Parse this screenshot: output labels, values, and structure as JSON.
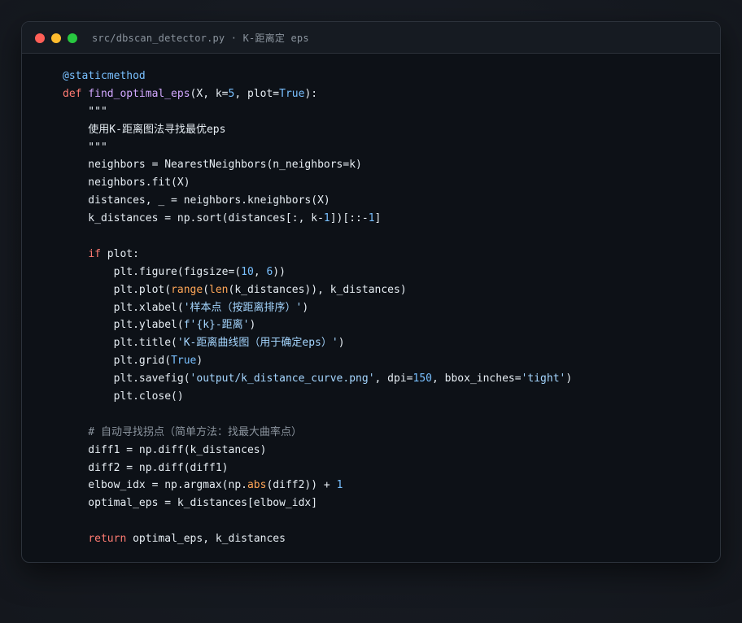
{
  "window": {
    "title": "src/dbscan_detector.py · K-距离定 eps",
    "controls": [
      "close",
      "minimize",
      "maximize"
    ]
  },
  "code": [
    [
      [
        "@staticmethod",
        "dec"
      ]
    ],
    [
      [
        "def ",
        "kw"
      ],
      [
        "find_optimal_eps",
        "fn"
      ],
      [
        "(X, k=",
        "plain"
      ],
      [
        "5",
        "num"
      ],
      [
        ", plot=",
        "plain"
      ],
      [
        "True",
        "const"
      ],
      [
        "):",
        "plain"
      ]
    ],
    [
      [
        "    \"\"\"",
        "doc"
      ]
    ],
    [
      [
        "    使用K-距离图法寻找最优eps",
        "doc"
      ]
    ],
    [
      [
        "    \"\"\"",
        "doc"
      ]
    ],
    [
      [
        "    neighbors = NearestNeighbors(n_neighbors=k)",
        "plain"
      ]
    ],
    [
      [
        "    neighbors.fit(X)",
        "plain"
      ]
    ],
    [
      [
        "    distances, _ = neighbors.kneighbors(X)",
        "plain"
      ]
    ],
    [
      [
        "    k_distances = np.sort(distances[:, k-",
        "plain"
      ],
      [
        "1",
        "num"
      ],
      [
        "])[::-",
        "plain"
      ],
      [
        "1",
        "num"
      ],
      [
        "]",
        "plain"
      ]
    ],
    [],
    [
      [
        "    ",
        "plain"
      ],
      [
        "if",
        "kw"
      ],
      [
        " plot:",
        "plain"
      ]
    ],
    [
      [
        "        plt.figure(figsize=(",
        "plain"
      ],
      [
        "10",
        "num"
      ],
      [
        ", ",
        "plain"
      ],
      [
        "6",
        "num"
      ],
      [
        "))",
        "plain"
      ]
    ],
    [
      [
        "        plt.plot(",
        "plain"
      ],
      [
        "range",
        "bi"
      ],
      [
        "(",
        "plain"
      ],
      [
        "len",
        "bi"
      ],
      [
        "(k_distances)), k_distances)",
        "plain"
      ]
    ],
    [
      [
        "        plt.xlabel(",
        "plain"
      ],
      [
        "'样本点（按距离排序）'",
        "str"
      ],
      [
        ")",
        "plain"
      ]
    ],
    [
      [
        "        plt.ylabel(",
        "plain"
      ],
      [
        "f'{k}-距离'",
        "str"
      ],
      [
        ")",
        "plain"
      ]
    ],
    [
      [
        "        plt.title(",
        "plain"
      ],
      [
        "'K-距离曲线图（用于确定eps）'",
        "str"
      ],
      [
        ")",
        "plain"
      ]
    ],
    [
      [
        "        plt.grid(",
        "plain"
      ],
      [
        "True",
        "const"
      ],
      [
        ")",
        "plain"
      ]
    ],
    [
      [
        "        plt.savefig(",
        "plain"
      ],
      [
        "'output/k_distance_curve.png'",
        "str"
      ],
      [
        ", dpi=",
        "plain"
      ],
      [
        "150",
        "num"
      ],
      [
        ", bbox_inches=",
        "plain"
      ],
      [
        "'tight'",
        "str"
      ],
      [
        ")",
        "plain"
      ]
    ],
    [
      [
        "        plt.close()",
        "plain"
      ]
    ],
    [],
    [
      [
        "    # 自动寻找拐点（简单方法：找最大曲率点）",
        "cmt"
      ]
    ],
    [
      [
        "    diff1 = np.diff(k_distances)",
        "plain"
      ]
    ],
    [
      [
        "    diff2 = np.diff(diff1)",
        "plain"
      ]
    ],
    [
      [
        "    elbow_idx = np.argmax(np.",
        "plain"
      ],
      [
        "abs",
        "bi"
      ],
      [
        "(diff2)) + ",
        "plain"
      ],
      [
        "1",
        "num"
      ]
    ],
    [
      [
        "    optimal_eps = k_distances[elbow_idx]",
        "plain"
      ]
    ],
    [],
    [
      [
        "    ",
        "plain"
      ],
      [
        "return",
        "kw"
      ],
      [
        " optimal_eps, k_distances",
        "plain"
      ]
    ]
  ]
}
